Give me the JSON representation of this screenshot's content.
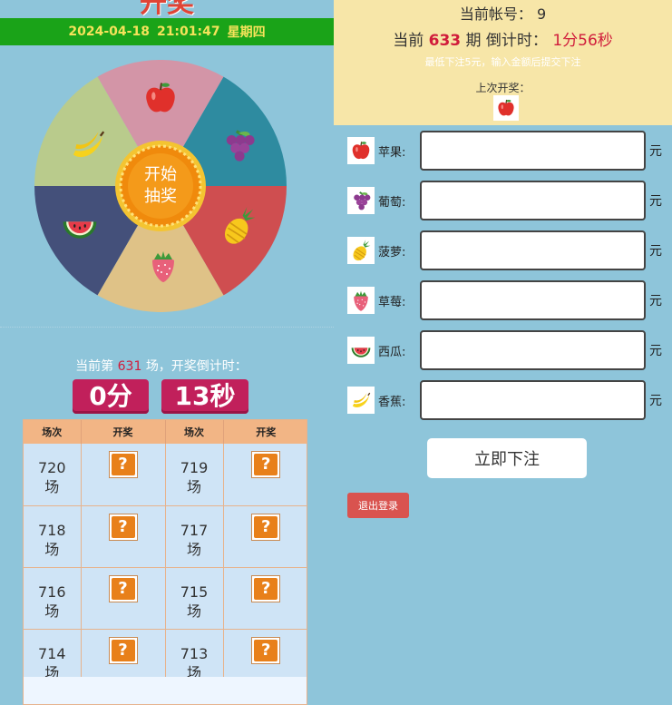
{
  "header": {
    "title": "开奖",
    "date": "2024-04-18",
    "time": "21:01:47",
    "weekday": "星期四"
  },
  "wheel": {
    "center_line1": "开始",
    "center_line2": "抽奖",
    "segments": [
      {
        "fruit": "apple-icon",
        "color": "#d395a7"
      },
      {
        "fruit": "grape-icon",
        "color": "#2e8ba0"
      },
      {
        "fruit": "pineapple-icon",
        "color": "#cf4e50"
      },
      {
        "fruit": "strawberry-icon",
        "color": "#dfc287"
      },
      {
        "fruit": "watermelon-icon",
        "color": "#44507a"
      },
      {
        "fruit": "banana-icon",
        "color": "#b9cb8c"
      }
    ]
  },
  "round": {
    "prefix": "当前第",
    "number": "631",
    "suffix": "场，开奖倒计时：",
    "minutes": "0分",
    "seconds": "13秒"
  },
  "history": {
    "headers": [
      "场次",
      "开奖",
      "场次",
      "开奖"
    ],
    "rows": [
      {
        "a_round": "720",
        "a_unit": "场",
        "a_prize": "?",
        "b_round": "719",
        "b_unit": "场",
        "b_prize": "?"
      },
      {
        "a_round": "718",
        "a_unit": "场",
        "a_prize": "?",
        "b_round": "717",
        "b_unit": "场",
        "b_prize": "?"
      },
      {
        "a_round": "716",
        "a_unit": "场",
        "a_prize": "?",
        "b_round": "715",
        "b_unit": "场",
        "b_prize": "?"
      },
      {
        "a_round": "714",
        "a_unit": "场",
        "a_prize": "?",
        "b_round": "713",
        "b_unit": "场",
        "b_prize": "?"
      }
    ]
  },
  "account": {
    "label": "当前帐号：",
    "value": "9"
  },
  "period": {
    "prefix": "当前",
    "number": "633",
    "middle": "期 倒计时：",
    "countdown": "1分56秒"
  },
  "hint": "最低下注5元，输入金额后提交下注",
  "last_draw": {
    "label": "上次开奖：",
    "fruit": "apple-icon"
  },
  "bets": [
    {
      "fruit": "apple-icon",
      "label": "苹果:",
      "value": "",
      "unit": "元"
    },
    {
      "fruit": "grape-icon",
      "label": "葡萄:",
      "value": "",
      "unit": "元"
    },
    {
      "fruit": "pineapple-icon",
      "label": "菠萝:",
      "value": "",
      "unit": "元"
    },
    {
      "fruit": "strawberry-icon",
      "label": "草莓:",
      "value": "",
      "unit": "元"
    },
    {
      "fruit": "watermelon-icon",
      "label": "西瓜:",
      "value": "",
      "unit": "元"
    },
    {
      "fruit": "banana-icon",
      "label": "香蕉:",
      "value": "",
      "unit": "元"
    }
  ],
  "actions": {
    "submit": "立即下注",
    "logout": "退出登录"
  }
}
